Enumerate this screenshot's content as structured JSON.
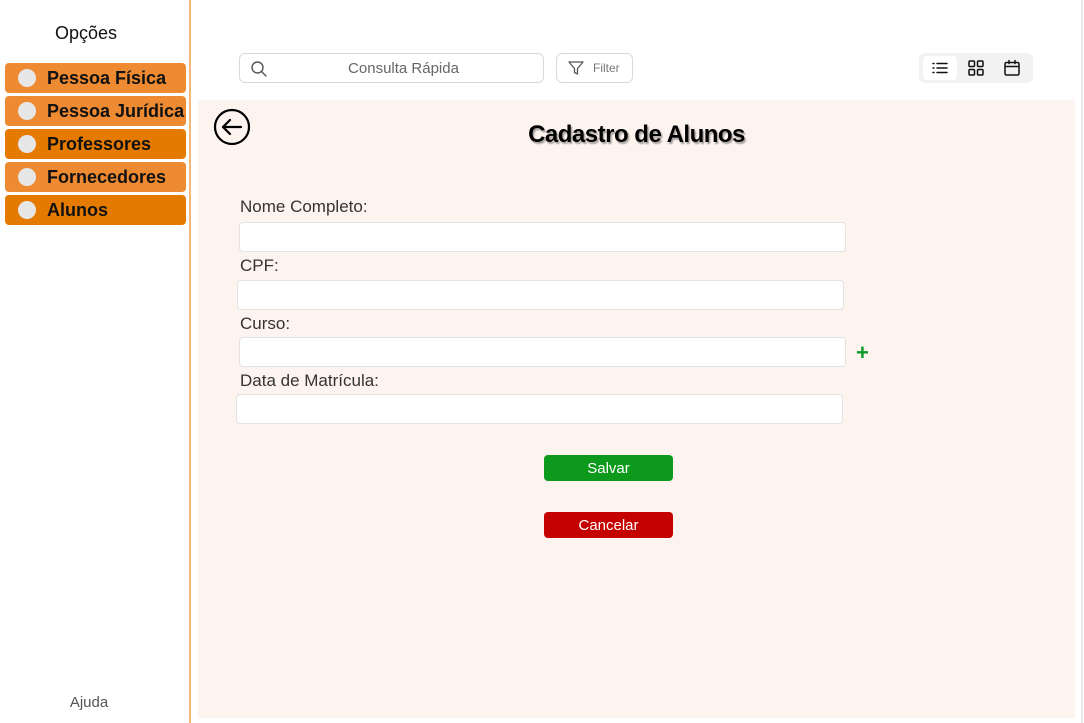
{
  "sidebar": {
    "title": "Opções",
    "items": [
      {
        "label": "Pessoa Física",
        "color": "#ee8a31"
      },
      {
        "label": "Pessoa Jurídica",
        "color": "#ee8a31"
      },
      {
        "label": "Professores",
        "color": "#e57a00"
      },
      {
        "label": "Fornecedores",
        "color": "#ee8a31"
      },
      {
        "label": "Alunos",
        "color": "#e57a00"
      }
    ],
    "help": "Ajuda"
  },
  "toolbar": {
    "search_placeholder": "Consulta Rápida",
    "filter_label": "Filter",
    "view_modes": [
      "list-view-icon",
      "grid-view-icon",
      "calendar-view-icon"
    ],
    "active_view": "list-view-icon"
  },
  "form": {
    "title": "Cadastro de Alunos",
    "fields": [
      {
        "label": "Nome Completo:",
        "value": ""
      },
      {
        "label": "CPF:",
        "value": ""
      },
      {
        "label": "Curso:",
        "value": ""
      },
      {
        "label": "Data de Matrícula:",
        "value": ""
      }
    ],
    "add_icon": "plus-icon",
    "save_label": "Salvar",
    "cancel_label": "Cancelar"
  },
  "colors": {
    "sidebar_border": "#f2b774",
    "panel_bg": "#fdf3ef",
    "save": "#0d9a1c",
    "cancel": "#c40000",
    "add": "#0a9a2a"
  }
}
